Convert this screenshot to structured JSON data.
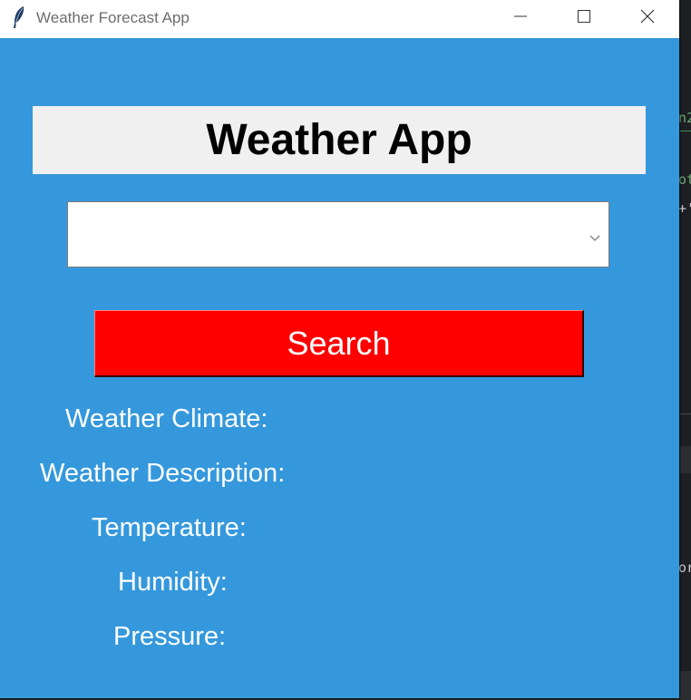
{
  "window": {
    "title": "Weather Forecast App"
  },
  "header": {
    "title": "Weather App"
  },
  "city_select": {
    "value": ""
  },
  "search_button": {
    "label": "Search"
  },
  "info_labels": {
    "climate": "Weather Climate:",
    "description": "Weather Description:",
    "temperature": "Temperature:",
    "humidity": "Humidity:",
    "pressure": "Pressure:"
  },
  "background_editor": {
    "fragments": [
      "n2",
      "ot",
      "+'",
      "or"
    ]
  },
  "colors": {
    "window_background": "#3598dc",
    "header_background": "#f0f0f0",
    "search_button": "#ff0000"
  },
  "icons": {
    "app": "feather-icon",
    "minimize": "minimize-icon",
    "maximize": "maximize-icon",
    "close": "close-icon",
    "dropdown": "chevron-down-icon"
  }
}
